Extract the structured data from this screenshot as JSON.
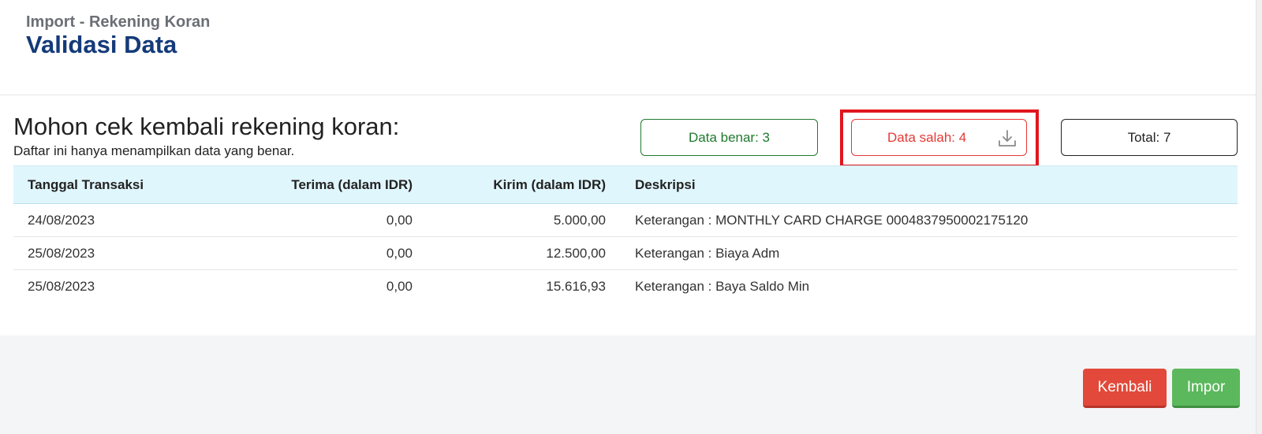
{
  "header": {
    "breadcrumb": "Import - Rekening Koran",
    "title": "Validasi Data"
  },
  "content": {
    "heading": "Mohon cek kembali rekening koran:",
    "subheading": "Daftar ini hanya menampilkan data yang benar."
  },
  "stats": {
    "correct": "Data benar: 3",
    "error": "Data salah: 4",
    "total": "Total: 7",
    "error_icon": "download-icon"
  },
  "table": {
    "columns": [
      "Tanggal Transaksi",
      "Terima (dalam IDR)",
      "Kirim (dalam IDR)",
      "Deskripsi"
    ],
    "rows": [
      [
        "24/08/2023",
        "0,00",
        "5.000,00",
        "Keterangan : MONTHLY CARD CHARGE 0004837950002175120"
      ],
      [
        "25/08/2023",
        "0,00",
        "12.500,00",
        "Keterangan : Biaya Adm"
      ],
      [
        "25/08/2023",
        "0,00",
        "15.616,93",
        "Keterangan : Baya Saldo Min"
      ]
    ]
  },
  "buttons": {
    "back": "Kembali",
    "import": "Impor"
  },
  "colors": {
    "title": "#143a78",
    "correct": "#1f7a2e",
    "error": "#e53935",
    "highlight": "#e0161e",
    "table_header_bg": "#e0f6fd",
    "back_button": "#e2493a",
    "import_button": "#5cb85c"
  }
}
